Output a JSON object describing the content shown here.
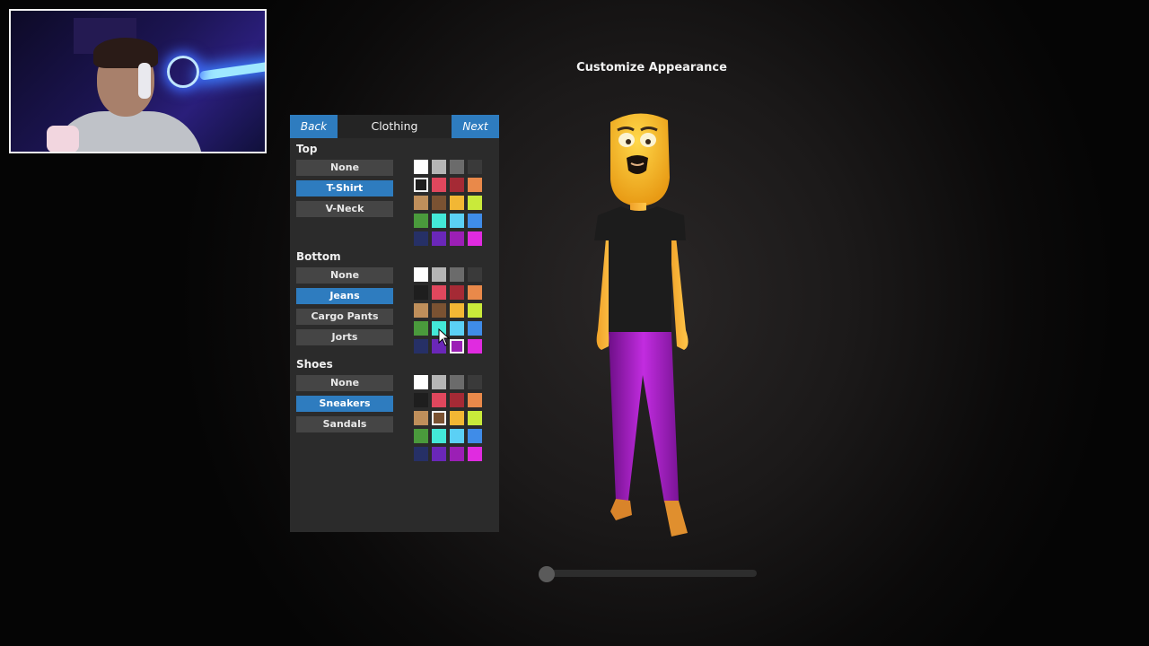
{
  "screen_title": "Customize Appearance",
  "panel": {
    "back_label": "Back",
    "title": "Clothing",
    "next_label": "Next"
  },
  "sections": [
    {
      "label": "Top",
      "options": [
        {
          "label": "None",
          "selected": false
        },
        {
          "label": "T-Shirt",
          "selected": true
        },
        {
          "label": "V-Neck",
          "selected": false
        }
      ],
      "selected_color": "#1e1e1e"
    },
    {
      "label": "Bottom",
      "options": [
        {
          "label": "None",
          "selected": false
        },
        {
          "label": "Jeans",
          "selected": true
        },
        {
          "label": "Cargo Pants",
          "selected": false
        },
        {
          "label": "Jorts",
          "selected": false
        }
      ],
      "selected_color": "#9b1fb5"
    },
    {
      "label": "Shoes",
      "options": [
        {
          "label": "None",
          "selected": false
        },
        {
          "label": "Sneakers",
          "selected": true
        },
        {
          "label": "Sandals",
          "selected": false
        }
      ],
      "selected_color": "#7a5232"
    }
  ],
  "palette": [
    [
      "#ffffff",
      "#b5b5b5",
      "#6b6b6b",
      "#3a3a3a"
    ],
    [
      "#1e1e1e",
      "#e0475d",
      "#a52a35",
      "#e9894a"
    ],
    [
      "#bf8f5b",
      "#7a5232",
      "#f2b734",
      "#c9ea3a"
    ],
    [
      "#4a9a3c",
      "#43e8d8",
      "#5bd0f5",
      "#3f8ce8"
    ],
    [
      "#263066",
      "#6a27b8",
      "#9b1fb5",
      "#e02be0"
    ]
  ],
  "colors": {
    "accent": "#2e7cbf",
    "panel_bg": "#2b2b2b",
    "option_bg": "#454545"
  },
  "slider": {
    "value": 0.0
  }
}
